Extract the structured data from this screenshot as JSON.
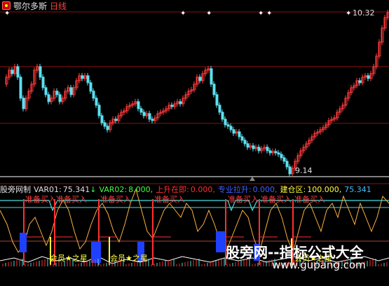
{
  "header": {
    "stock_name": "鄂尔多斯",
    "period": "日线"
  },
  "price_panel": {
    "max_label": "10.32",
    "min_label": "9.14"
  },
  "indicator": {
    "name": "股旁网制",
    "var01_label": "VAR01:",
    "var01_value": "75.341",
    "var01_arrow": "↓",
    "var02_label": "VAR02:",
    "var02_value": "8.000,",
    "rise_label": "上升在即:",
    "rise_value": "0.000,",
    "pull_label": "专业拉升:",
    "pull_value": "0.000,",
    "build_label": "建仓区:",
    "build_value": "100.000,",
    "extra_value": "75.341"
  },
  "signals": {
    "buy_label": "准备买入",
    "member_label": "会员★之星"
  },
  "watermark": {
    "line1": "股旁网--指标公式大全",
    "line2": "www.gupang.com"
  },
  "colors": {
    "background": "#000000",
    "candle_up": "#ff3c3c",
    "candle_down": "#5ce0f0",
    "grid": "#8b1010",
    "var01": "#e0e0e0",
    "var02": "#40ff40",
    "rise": "#ff3030",
    "pull": "#4060ff",
    "build": "#ffff40",
    "extra": "#40c0ff"
  },
  "icons": {
    "logo": "stock-logo-icon",
    "flag": "star-flag-icon"
  }
}
